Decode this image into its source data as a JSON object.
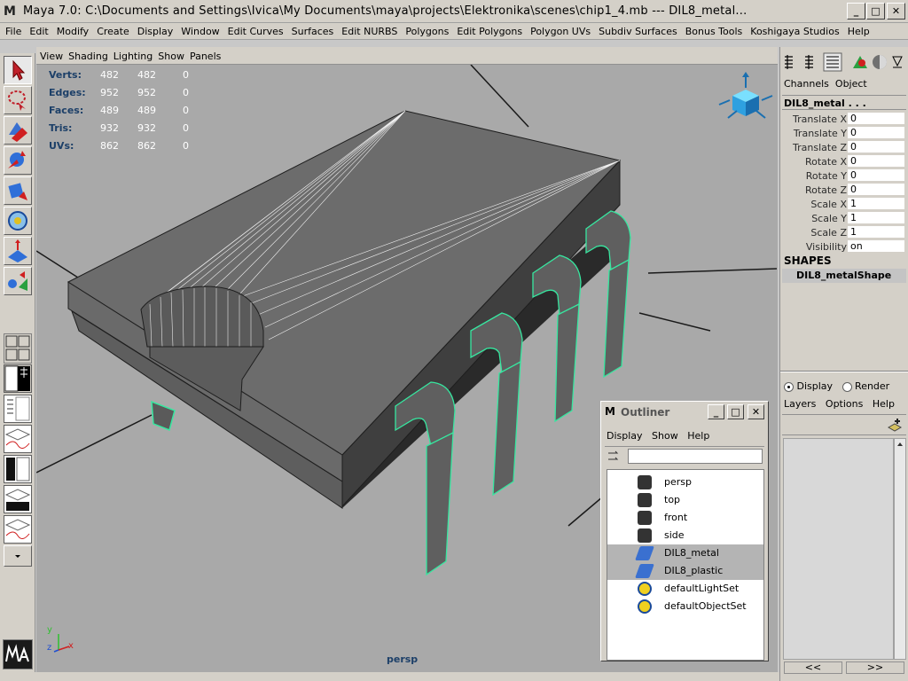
{
  "window": {
    "title": "Maya 7.0: C:\\Documents and Settings\\Ivica\\My Documents\\maya\\projects\\Elektronika\\scenes\\chip1_4.mb   ---   DIL8_metal...",
    "buttons": {
      "minimize": "_",
      "maximize": "□",
      "close": "✕"
    }
  },
  "menu": [
    "File",
    "Edit",
    "Modify",
    "Create",
    "Display",
    "Window",
    "Edit Curves",
    "Surfaces",
    "Edit NURBS",
    "Polygons",
    "Edit Polygons",
    "Polygon UVs",
    "Subdiv Surfaces",
    "Bonus Tools",
    "Koshigaya Studios",
    "Help"
  ],
  "viewport": {
    "menu": [
      "View",
      "Shading",
      "Lighting",
      "Show",
      "Panels"
    ],
    "stats": [
      {
        "label": "Verts:",
        "a": "482",
        "b": "482",
        "c": "0"
      },
      {
        "label": "Edges:",
        "a": "952",
        "b": "952",
        "c": "0"
      },
      {
        "label": "Faces:",
        "a": "489",
        "b": "489",
        "c": "0"
      },
      {
        "label": "Tris:",
        "a": "932",
        "b": "932",
        "c": "0"
      },
      {
        "label": "UVs:",
        "a": "862",
        "b": "862",
        "c": "0"
      }
    ],
    "camera": "persp",
    "axis": {
      "y": "y",
      "z": "z",
      "x": "x"
    }
  },
  "channel_box": {
    "tabs": [
      "Channels",
      "Object"
    ],
    "object_name": "DIL8_metal . . .",
    "channels": [
      {
        "name": "Translate X",
        "value": "0"
      },
      {
        "name": "Translate Y",
        "value": "0"
      },
      {
        "name": "Translate Z",
        "value": "0"
      },
      {
        "name": "Rotate X",
        "value": "0"
      },
      {
        "name": "Rotate Y",
        "value": "0"
      },
      {
        "name": "Rotate Z",
        "value": "0"
      },
      {
        "name": "Scale X",
        "value": "1"
      },
      {
        "name": "Scale Y",
        "value": "1"
      },
      {
        "name": "Scale Z",
        "value": "1"
      },
      {
        "name": "Visibility",
        "value": "on"
      }
    ],
    "shapes_header": "SHAPES",
    "shape_name": "DIL8_metalShape"
  },
  "layer_editor": {
    "options": [
      "Display",
      "Render"
    ],
    "selected": "Display",
    "menu": [
      "Layers",
      "Options",
      "Help"
    ],
    "nav": [
      "<<",
      ">>"
    ]
  },
  "outliner": {
    "title": "Outliner",
    "menu": [
      "Display",
      "Show",
      "Help"
    ],
    "items": [
      {
        "label": "persp",
        "icon": "camera-icon",
        "selected": false
      },
      {
        "label": "top",
        "icon": "camera-icon",
        "selected": false
      },
      {
        "label": "front",
        "icon": "camera-icon",
        "selected": false
      },
      {
        "label": "side",
        "icon": "camera-icon",
        "selected": false
      },
      {
        "label": "DIL8_metal",
        "icon": "mesh-icon",
        "selected": true
      },
      {
        "label": "DIL8_plastic",
        "icon": "mesh-icon",
        "selected": true
      },
      {
        "label": "defaultLightSet",
        "icon": "set-icon",
        "selected": false
      },
      {
        "label": "defaultObjectSet",
        "icon": "set-icon",
        "selected": false
      }
    ]
  },
  "brand": "MAYA",
  "colors": {
    "hud_label": "#1c3f68",
    "selection_wire": "#37e7a0",
    "viewport_bg": "#a9a9a9",
    "panel": "#d4d0c8"
  }
}
